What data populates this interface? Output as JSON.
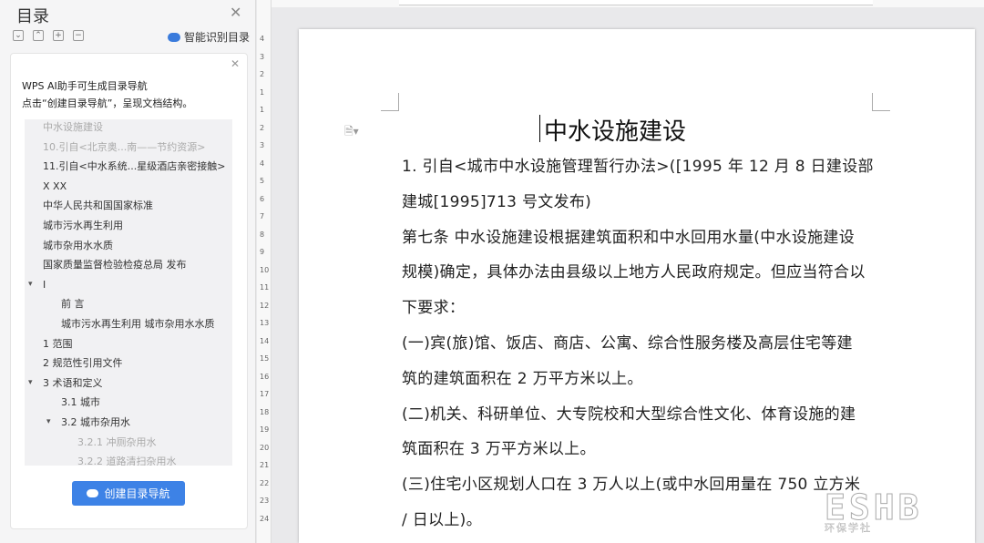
{
  "toc": {
    "title": "目录",
    "smart_label": "智能识别目录",
    "hint1": "WPS AI助手可生成目录导航",
    "hint2": "点击“创建目录导航”，呈现文档结构。",
    "items": [
      {
        "text": "中水设施建设",
        "dim": true
      },
      {
        "text": "10.引自<北京奥...南——节约资源>",
        "dim": true
      },
      {
        "text": "11.引自<中水系统...星级酒店亲密接触>",
        "dim": false
      },
      {
        "text": "X XX",
        "dim": false
      },
      {
        "text": "中华人民共和国国家标准",
        "dim": false
      },
      {
        "text": "城市污水再生利用",
        "dim": false
      },
      {
        "text": "城市杂用水水质",
        "dim": false
      },
      {
        "text": "国家质量监督检验检疫总局 发布",
        "dim": false
      },
      {
        "text": "I",
        "dim": false
      },
      {
        "text": "前 言",
        "dim": false
      },
      {
        "text": "城市污水再生利用 城市杂用水水质",
        "dim": false
      },
      {
        "text": "1 范围",
        "dim": false
      },
      {
        "text": "2 规范性引用文件",
        "dim": false
      },
      {
        "text": "3 术语和定义",
        "dim": false
      },
      {
        "text": "3.1 城市",
        "dim": false
      },
      {
        "text": "3.2 城市杂用水",
        "dim": false
      },
      {
        "text": "3.2.1 冲厕杂用水",
        "dim": true
      },
      {
        "text": "3.2.2 道路清扫杂用水",
        "dim": true
      }
    ],
    "create_button": "创建目录导航"
  },
  "ruler_ticks": [
    "4",
    "3",
    "2",
    "1",
    "1",
    "2",
    "3",
    "4",
    "5",
    "6",
    "7",
    "8",
    "9",
    "10",
    "11",
    "12",
    "13",
    "14",
    "15",
    "16",
    "17",
    "18",
    "19",
    "20",
    "21",
    "22",
    "23",
    "24"
  ],
  "doc": {
    "title": "中水设施建设",
    "lines": [
      "1. 引自<城市中水设施管理暂行办法>([1995 年 12 月 8 日建设部",
      "建城[1995]713 号文发布)",
      "第七条  中水设施建设根据建筑面积和中水回用水量(中水设施建设",
      "规模)确定，具体办法由县级以上地方人民政府规定。但应当符合以",
      "下要求：",
      "  (一)宾(旅)馆、饭店、商店、公寓、综合性服务楼及高层住宅等建",
      "筑的建筑面积在 2 万平方米以上。",
      "  (二)机关、科研单位、大专院校和大型综合性文化、体育设施的建",
      "筑面积在 3 万平方米以上。",
      "  (三)住宅小区规划人口在 3 万人以上(或中水回用量在 750 立方米",
      " / 日以上)。"
    ]
  },
  "watermark": {
    "big": "ESHB",
    "small": "环保学社"
  }
}
